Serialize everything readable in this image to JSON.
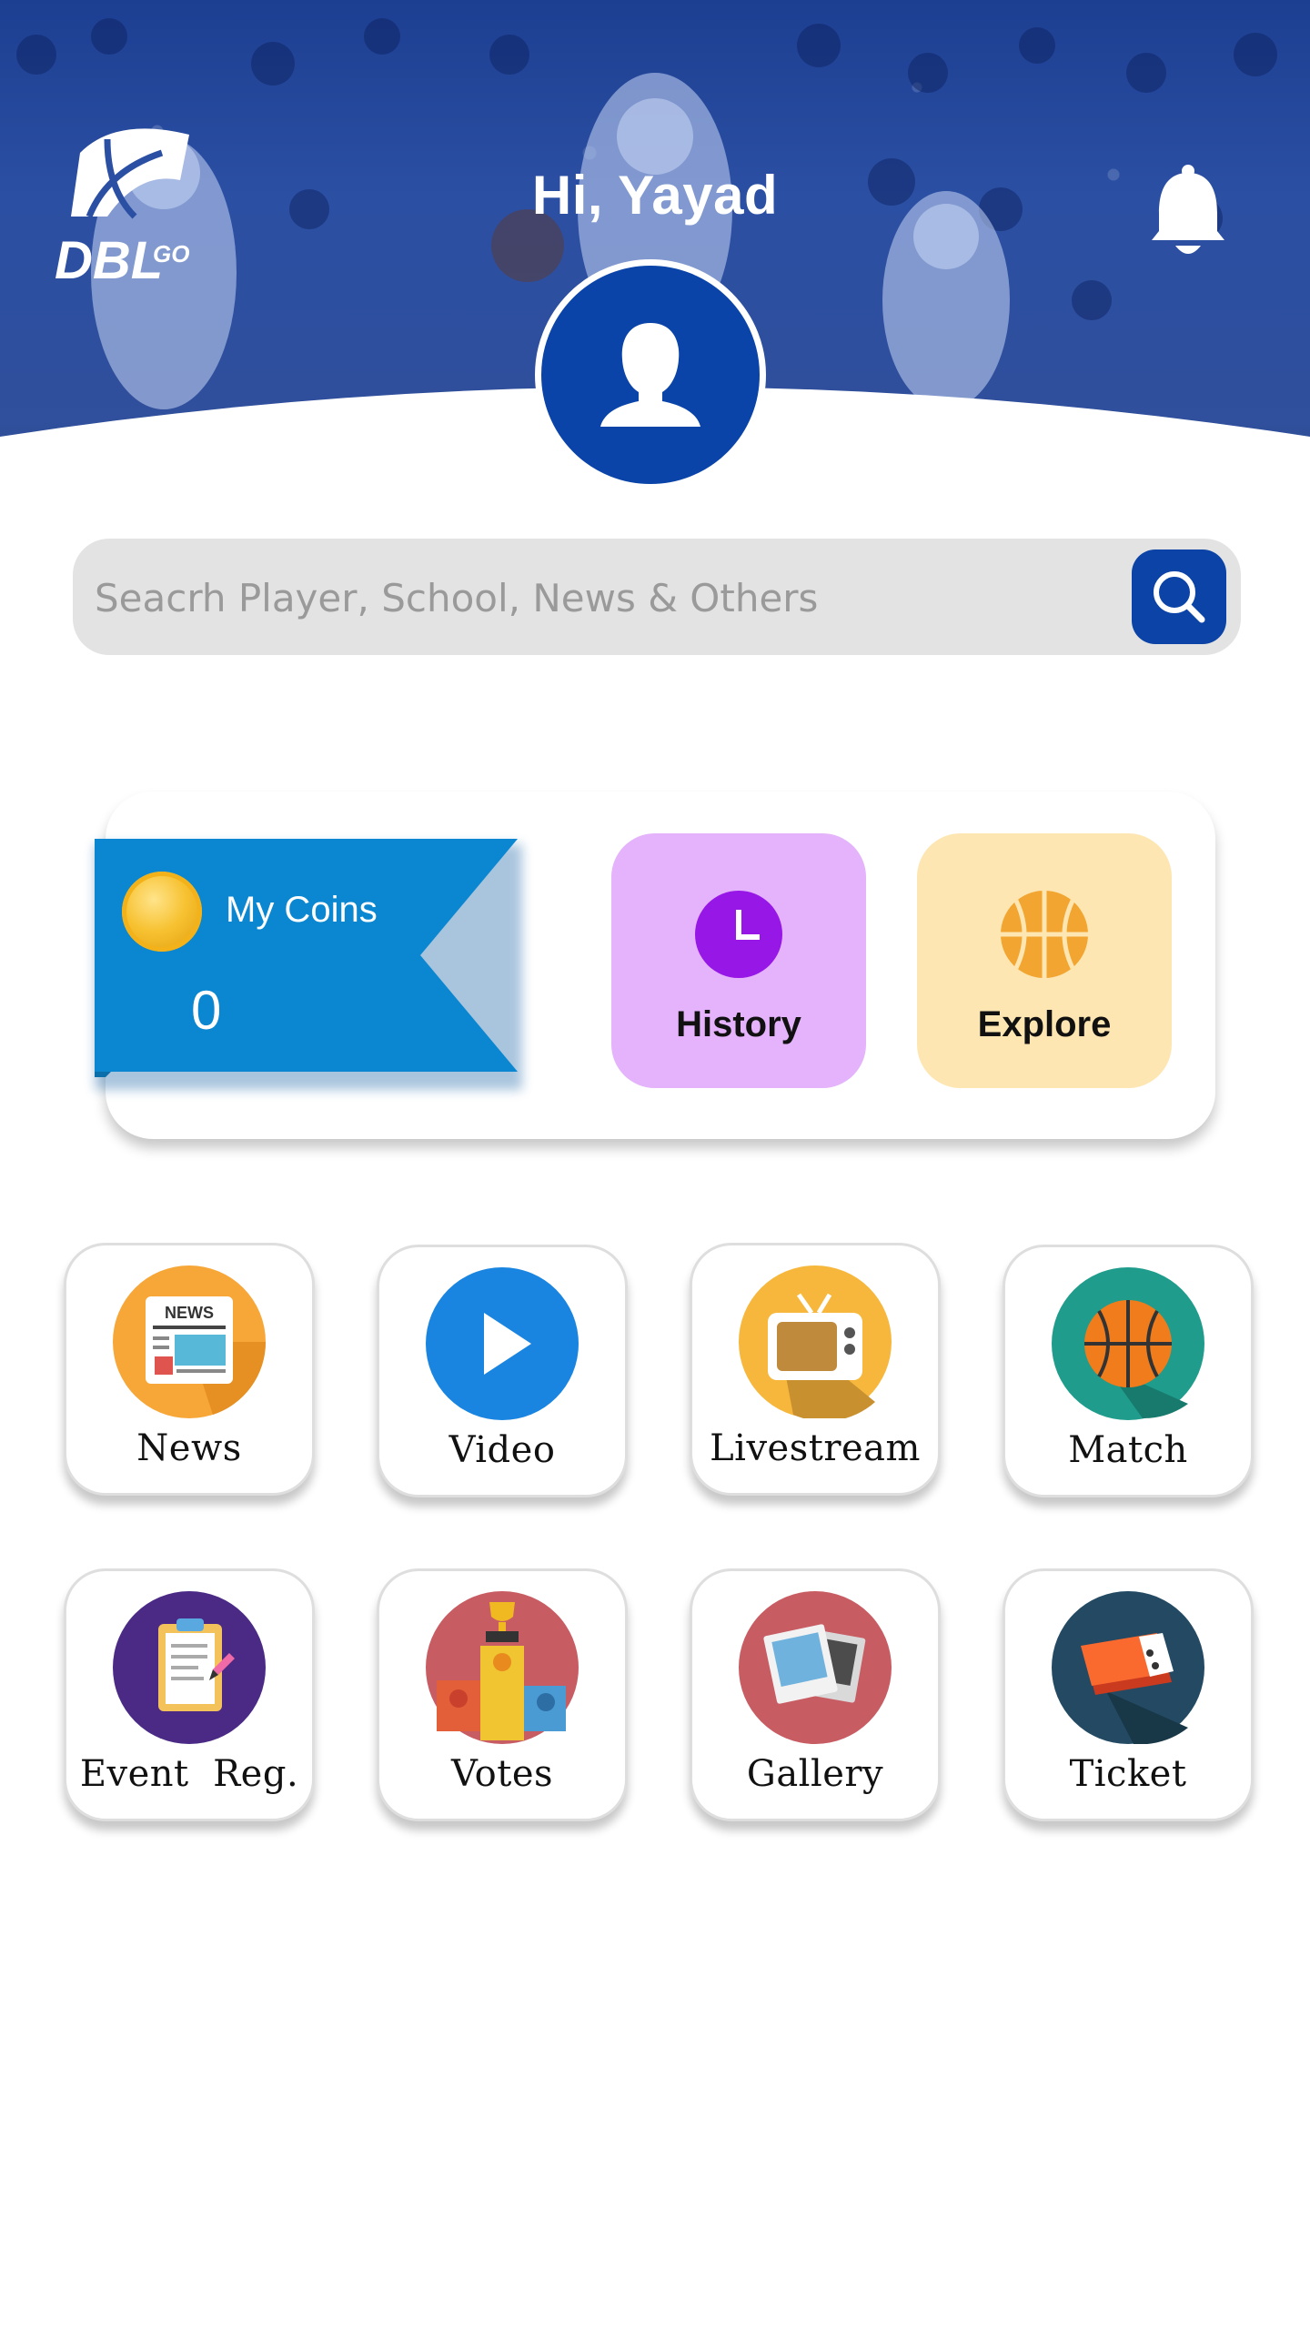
{
  "header": {
    "greeting": "Hi, Yayad",
    "logo_text": "DBLGO"
  },
  "search": {
    "placeholder": "Seacrh Player, School, News & Others"
  },
  "coins": {
    "label": "My Coins",
    "value": "0"
  },
  "quick_tiles": [
    {
      "label": "History",
      "icon": "clock-icon",
      "color": "#e4b3fb"
    },
    {
      "label": "Explore",
      "icon": "basketball-icon",
      "color": "#fde6b1"
    }
  ],
  "menu": [
    {
      "label": "News",
      "icon": "newspaper-icon"
    },
    {
      "label": "Video",
      "icon": "play-icon"
    },
    {
      "label": "Livestream",
      "icon": "tv-icon"
    },
    {
      "label": "Match",
      "icon": "basketball-icon"
    },
    {
      "label": "Event  Reg.",
      "icon": "clipboard-icon"
    },
    {
      "label": "Votes",
      "icon": "podium-icon"
    },
    {
      "label": "Gallery",
      "icon": "photos-icon"
    },
    {
      "label": "Ticket",
      "icon": "ticket-icon"
    }
  ],
  "colors": {
    "primary": "#0b43a6",
    "ribbon": "#0a87d0",
    "history": "#e4b3fb",
    "explore": "#fde6b1"
  }
}
